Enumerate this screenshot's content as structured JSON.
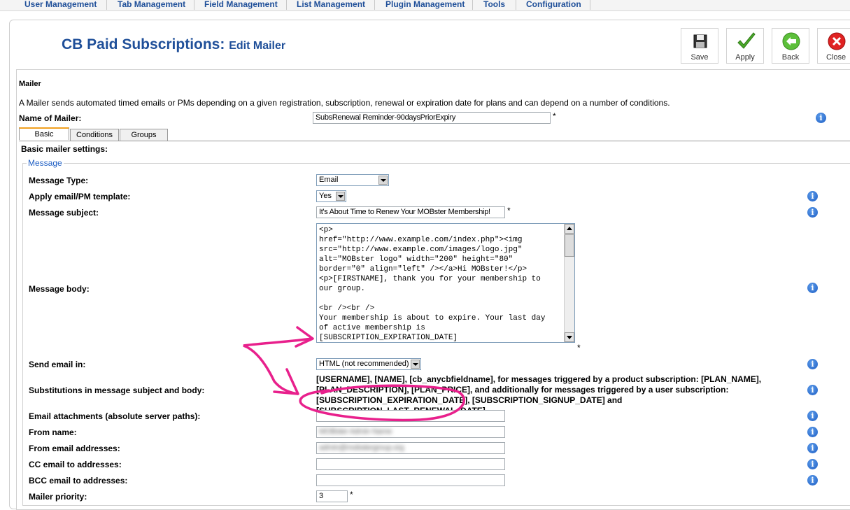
{
  "menu": [
    "User Management",
    "Tab Management",
    "Field Management",
    "List Management",
    "Plugin Management",
    "Tools",
    "Configuration"
  ],
  "page": {
    "title": "CB Paid Subscriptions:",
    "subtitle": "Edit Mailer"
  },
  "toolbar": {
    "save": "Save",
    "apply": "Apply",
    "back": "Back",
    "close": "Close"
  },
  "section": {
    "heading": "Mailer",
    "description": "A Mailer sends automated timed emails or PMs depending on a given registration, subscription, renewal or expiration date for plans and can depend on a number of conditions.",
    "name_label": "Name of Mailer:",
    "name_value": "SubsRenewal Reminder-90daysPriorExpiry",
    "required": "*"
  },
  "tabs": [
    "Basic",
    "Conditions",
    "Groups"
  ],
  "basic": {
    "heading": "Basic mailer settings:",
    "legend": "Message",
    "labels": {
      "message_type": "Message Type:",
      "apply_template": "Apply email/PM template:",
      "subject": "Message subject:",
      "body": "Message body:",
      "send_in": "Send email in:",
      "substitutions": "Substitutions in message subject and body:",
      "attachments": "Email attachments (absolute server paths):",
      "from_name": "From name:",
      "from_email": "From email addresses:",
      "cc": "CC email to addresses:",
      "bcc": "BCC email to addresses:",
      "priority": "Mailer priority:"
    },
    "values": {
      "message_type": "Email",
      "apply_template": "Yes",
      "subject": "It's About Time to Renew Your MOBster Membership!",
      "body": "<p>\nhref=\"http://www.example.com/index.php\"><img\nsrc=\"http://www.example.com/images/logo.jpg\"\nalt=\"MOBster logo\" width=\"200\" height=\"80\"\nborder=\"0\" align=\"left\" /></a>Hi MOBster!</p>\n<p>[FIRSTNAME], thank you for your membership to\nour group.\n\n<br /><br />\nYour membership is about to expire. Your last day\nof active membership is\n[SUBSCRIPTION_EXPIRATION_DATE]\n<br /><br />",
      "send_in": "HTML (not recommended)",
      "substitutions": "[USERNAME], [NAME], [cb_anycbfieldname], for messages triggered by a product subscription: [PLAN_NAME], [PLAN_DESCRIPTION], [PLAN_PRICE], and additionally for messages triggered by a user subscription: [SUBSCRIPTION_EXPIRATION_DATE], [SUBSCRIPTION_SIGNUP_DATE] and [SUBSCRIPTION_LAST_RENEWAL_DATE].",
      "attachments": "",
      "from_name": "MOBster Admin Name",
      "from_email": "admin@mobstergroup.org",
      "cc": "",
      "bcc": "",
      "priority": "3"
    }
  },
  "colors": {
    "link_blue": "#1f4f99",
    "annotation": "#e8208c"
  }
}
